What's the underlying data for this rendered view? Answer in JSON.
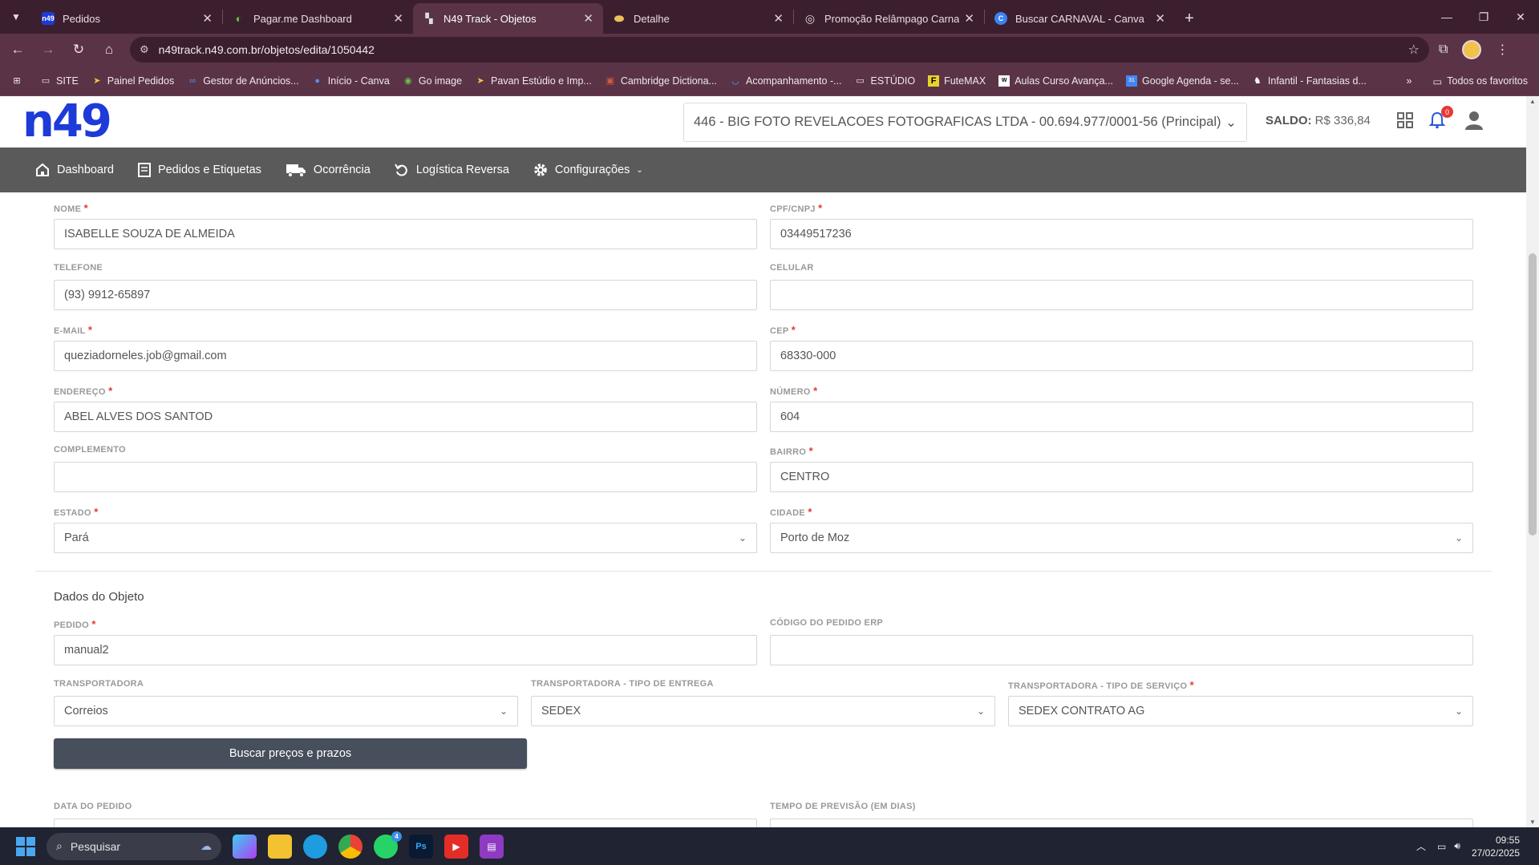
{
  "browser": {
    "tabs": [
      {
        "title": "Pedidos",
        "fav_text": "n49",
        "fav_bg": "#1e3ad8"
      },
      {
        "title": "Pagar.me Dashboard",
        "fav_text": "",
        "fav_bg": "#65a30d"
      },
      {
        "title": "N49 Track - Objetos",
        "fav_text": "",
        "fav_bg": "#444"
      },
      {
        "title": "Detalhe",
        "fav_text": "",
        "fav_bg": "#e8c45a"
      },
      {
        "title": "Promoção Relâmpago Carnaval",
        "fav_text": "",
        "fav_bg": "#bbb"
      },
      {
        "title": "Buscar CARNAVAL - Canva",
        "fav_text": "C",
        "fav_bg": "#3b82f6"
      }
    ],
    "url": "n49track.n49.com.br/objetos/edita/1050442",
    "bookmarks": [
      "SITE",
      "Painel Pedidos",
      "Gestor de Anúncios...",
      "Início - Canva",
      "Go image",
      "Pavan Estúdio e Imp...",
      "Cambridge Dictiona...",
      "Acompanhamento -...",
      "ESTÚDIO",
      "FuteMAX",
      "Aulas Curso Avança...",
      "Google Agenda - se...",
      "Infantil - Fantasias d..."
    ],
    "all_bookmarks": "Todos os favoritos"
  },
  "header": {
    "logo": "n49",
    "company": "446 - BIG FOTO REVELACOES FOTOGRAFICAS LTDA - 00.694.977/0001-56 (Principal)",
    "saldo_label": "SALDO:",
    "saldo_value": "R$ 336,84",
    "notifications": "0"
  },
  "nav": [
    "Dashboard",
    "Pedidos e Etiquetas",
    "Ocorrência",
    "Logística Reversa",
    "Configurações"
  ],
  "form": {
    "nome": {
      "label": "NOME",
      "value": "ISABELLE SOUZA DE ALMEIDA"
    },
    "cpf": {
      "label": "CPF/CNPJ",
      "value": "03449517236"
    },
    "telefone": {
      "label": "TELEFONE",
      "value": "(93) 9912-65897"
    },
    "celular": {
      "label": "CELULAR",
      "value": ""
    },
    "email": {
      "label": "E-MAIL",
      "value": "queziadorneles.job@gmail.com"
    },
    "cep": {
      "label": "CEP",
      "value": "68330-000"
    },
    "endereco": {
      "label": "ENDEREÇO",
      "value": "ABEL ALVES DOS SANTOD"
    },
    "numero": {
      "label": "NÚMERO",
      "value": "604"
    },
    "complemento": {
      "label": "COMPLEMENTO",
      "value": ""
    },
    "bairro": {
      "label": "BAIRRO",
      "value": "CENTRO"
    },
    "estado": {
      "label": "ESTADO",
      "value": "Pará"
    },
    "cidade": {
      "label": "CIDADE",
      "value": "Porto de Moz"
    },
    "section_title": "Dados do Objeto",
    "pedido": {
      "label": "PEDIDO",
      "value": "manual2"
    },
    "codigo_erp": {
      "label": "CÓDIGO DO PEDIDO ERP",
      "value": ""
    },
    "transportadora": {
      "label": "TRANSPORTADORA",
      "value": "Correios"
    },
    "tipo_entrega": {
      "label": "TRANSPORTADORA - TIPO DE ENTREGA",
      "value": "SEDEX"
    },
    "tipo_servico": {
      "label": "TRANSPORTADORA - TIPO DE SERVIÇO",
      "value": "SEDEX CONTRATO AG"
    },
    "buscar_btn": "Buscar preços e prazos",
    "data_pedido": {
      "label": "DATA DO PEDIDO"
    },
    "tempo_previsao": {
      "label": "TEMPO DE PREVISÃO (EM DIAS)"
    }
  },
  "taskbar": {
    "search": "Pesquisar",
    "time": "09:55",
    "date": "27/02/2025",
    "whatsapp_badge": "4"
  }
}
